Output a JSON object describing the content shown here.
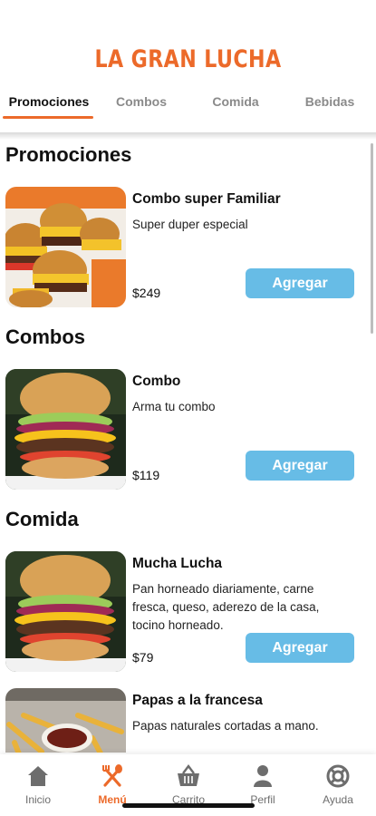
{
  "app": {
    "title": "LA GRAN LUCHA"
  },
  "colors": {
    "brand": "#ec6a2a",
    "button": "#67bce6",
    "text": "#111111",
    "muted": "#8a8a8a"
  },
  "tabs": [
    {
      "label": "Promociones",
      "active": true
    },
    {
      "label": "Combos",
      "active": false
    },
    {
      "label": "Comida",
      "active": false
    },
    {
      "label": "Bebidas",
      "active": false
    }
  ],
  "sections": [
    {
      "title": "Promociones",
      "items": [
        {
          "name": "Combo super Familiar",
          "description": "Super duper especial",
          "price": "$249",
          "button": "Agregar",
          "image": "sliders-burgers-photo"
        }
      ]
    },
    {
      "title": "Combos",
      "items": [
        {
          "name": "Combo",
          "description": "Arma tu combo",
          "price": "$119",
          "button": "Agregar",
          "image": "cheeseburger-photo"
        }
      ]
    },
    {
      "title": "Comida",
      "items": [
        {
          "name": "Mucha Lucha",
          "description": "Pan horneado diariamente, carne fresca, queso, aderezo de la casa, tocino horneado.",
          "price": "$79",
          "button": "Agregar",
          "image": "cheeseburger-photo"
        },
        {
          "name": "Papas a la francesa",
          "description": "Papas naturales cortadas a mano.",
          "price": "",
          "button": "",
          "image": "french-fries-photo"
        }
      ]
    }
  ],
  "bottom_nav": [
    {
      "label": "Inicio",
      "icon": "home-icon",
      "active": false
    },
    {
      "label": "Menú",
      "icon": "utensils-icon",
      "active": true
    },
    {
      "label": "Carrito",
      "icon": "basket-icon",
      "active": false
    },
    {
      "label": "Perfil",
      "icon": "user-icon",
      "active": false
    },
    {
      "label": "Ayuda",
      "icon": "lifebuoy-icon",
      "active": false
    }
  ]
}
